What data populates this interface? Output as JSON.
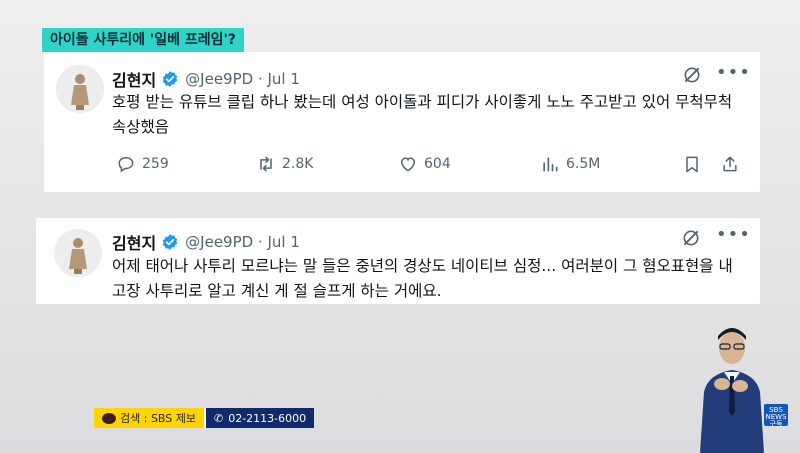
{
  "headline": "아이돌 사투리에 '일베 프레임'?",
  "tweets": [
    {
      "name": "김현지",
      "handle": "@Jee9PD · Jul 1",
      "text": "호평 받는 유튜브 클립 하나 봤는데 여성 아이돌과 피디가 사이좋게 노노 주고받고 있어 무척무척 속상했음",
      "stats": {
        "replies": "259",
        "reposts": "2.8K",
        "likes": "604",
        "views": "6.5M"
      }
    },
    {
      "name": "김현지",
      "handle": "@Jee9PD · Jul 1",
      "text": "어제 태어나 사투리 모르냐는 말 들은 중년의 경상도 네이티브 심정... 여러분이 그 혐오표현을 내고장 사투리로 알고 계신 게 절 슬프게 하는 거에요."
    }
  ],
  "ticker": {
    "search": "검색 : SBS 제보",
    "phone": "02-2113-6000"
  },
  "sbs_badge": {
    "line1": "SBS",
    "line2": "NEWS",
    "line3": "구독"
  },
  "colors": {
    "headline_bg": "#2fd3c8",
    "verified": "#1d9bf0",
    "ticker_yellow": "#ffd400",
    "ticker_navy": "#102a6b"
  }
}
